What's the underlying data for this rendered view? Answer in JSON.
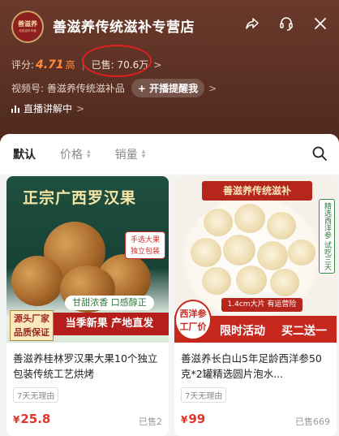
{
  "store": {
    "name": "善滋养传统滋补专营店",
    "logo_text": "善滋养",
    "logo_subtext": "传统滋补专营"
  },
  "stats": {
    "rating_label": "评分:",
    "rating_value": "4.71",
    "rating_level": "高",
    "sold_label": "已售: 70.6万"
  },
  "channel": {
    "label": "视频号: 善滋养传统滋补品",
    "remind_button": "+ 开播提醒我"
  },
  "live": {
    "label": "直播讲解中"
  },
  "tabs": [
    {
      "label": "默认"
    },
    {
      "label": "价格"
    },
    {
      "label": "销量"
    }
  ],
  "products": [
    {
      "title": "善滋养桂林罗汉果大果10个独立包装传统工艺烘烤",
      "tag": "7天无理由",
      "currency": "¥",
      "price": "25.8",
      "sold": "已售2",
      "image": {
        "headline": "正宗广西罗汉果",
        "badge_line1": "手选大果",
        "badge_line2": "独立包装",
        "pill": "甘甜浓香 口感醇正",
        "banner": "当季新果 产地直发",
        "corner_line1": "源头厂家",
        "corner_line2": "品质保证"
      }
    },
    {
      "title": "善滋养长白山5年足龄西洋参50克*2罐精选圆片泡水...",
      "tag": "7天无理由",
      "currency": "¥",
      "price": "99",
      "sold": "已售669",
      "image": {
        "top_banner": "善滋养传统滋补",
        "side_tag": "精选西洋参 试吃三天",
        "size_pill": "1.4cm大片 有运营险",
        "badge_line1": "西洋参",
        "badge_line2": "工厂价",
        "promo_a": "限时活动",
        "promo_b": "买二送一"
      }
    }
  ],
  "colors": {
    "header_bg": "#5a2f22",
    "accent_orange": "#ff8a3d",
    "price_red": "#e0352b",
    "annotation_circle": "#e02020"
  }
}
